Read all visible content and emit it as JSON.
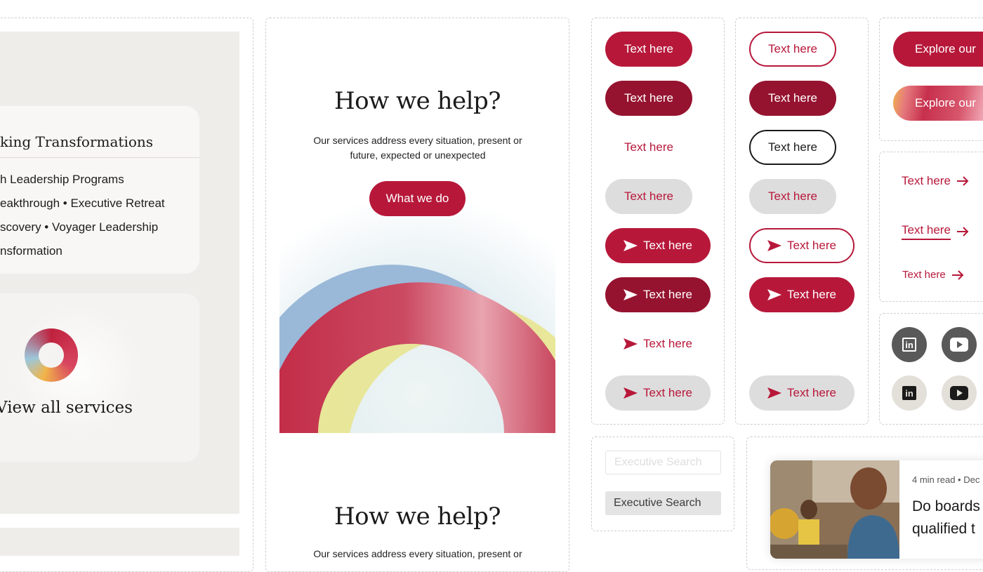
{
  "left": {
    "card_title": "king Transformations",
    "programs": [
      "h Leadership Programs",
      "eakthrough • Executive Retreat",
      "scovery • Voyager Leadership",
      "nsformation"
    ],
    "view_all_label": "View all services"
  },
  "hero": {
    "title": "How we help?",
    "subtitle": "Our services address every situation, present or future, expected or unexpected",
    "cta_label": "What we do",
    "title_repeat": "How we help?",
    "subtitle_repeat_partial": "Our services address every situation, present or"
  },
  "buttons": {
    "label": "Text here"
  },
  "explore": {
    "label": "Explore our"
  },
  "links": {
    "label": "Text here"
  },
  "social": {
    "linkedin": "in",
    "icons": [
      "linkedin-icon",
      "youtube-icon"
    ]
  },
  "search_chips": {
    "ghost": "Executive Search",
    "filled": "Executive Search"
  },
  "article": {
    "meta": "4 min read • Dec",
    "title_line1": "Do boards",
    "title_line2": "qualified t"
  },
  "colors": {
    "brand_red": "#b7183a",
    "brand_dark_red": "#95132f",
    "grey_pill": "#dedddd",
    "panel_bg": "#efedea"
  }
}
